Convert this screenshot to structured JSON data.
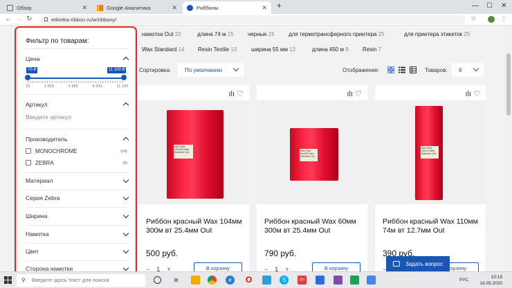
{
  "browser": {
    "tabs": [
      {
        "title": "Обзор",
        "icon": "doc-icon"
      },
      {
        "title": "Google Аналитика",
        "icon": "analytics-icon"
      },
      {
        "title": "Риббоны",
        "icon": "site-icon"
      }
    ],
    "new_tab": "+",
    "url": "etiketka-ribbon.ru/w/ribbony/"
  },
  "tags_row1": [
    {
      "label": "намотка Out",
      "count": "32"
    },
    {
      "label": "длина 74 м",
      "count": "25"
    },
    {
      "label": "черные",
      "count": "25"
    },
    {
      "label": "для термотрансферного принтера",
      "count": "25"
    },
    {
      "label": "для принтера этикеток",
      "count": "25"
    }
  ],
  "tags_row2": [
    {
      "label": "Wax Standard",
      "count": "14"
    },
    {
      "label": "Resin Textile",
      "count": "13"
    },
    {
      "label": "ширина 55 мм",
      "count": "12"
    },
    {
      "label": "длина 450 м",
      "count": "8"
    },
    {
      "label": "Resin",
      "count": "7"
    }
  ],
  "filter": {
    "title": "Фильтр по товарам:",
    "price": {
      "label": "Цена",
      "min_badge": "70 ₽",
      "max_badge": "11 100 ₽",
      "ticks": [
        "70",
        "2 828",
        "5 585",
        "8 343",
        "11 100"
      ]
    },
    "article": {
      "label": "Артикул",
      "placeholder": "Введите артикул"
    },
    "maker": {
      "label": "Производитель",
      "options": [
        {
          "label": "MONOCHROME",
          "count": "(14)",
          "checked": false
        },
        {
          "label": "ZEBRA",
          "count": "(9)",
          "checked": false
        }
      ]
    },
    "collapsed": [
      "Материал",
      "Серия Zebra",
      "Ширина",
      "Намотка",
      "Цвет",
      "Сторона намотки"
    ]
  },
  "sort": {
    "label": "Сортировка:",
    "value": "По умолчанию"
  },
  "display": {
    "label": "Отображение:"
  },
  "goods": {
    "label": "Товаров:",
    "value": "6"
  },
  "products": [
    {
      "name": "Риббон красный Wax 104мм 300м вт 25.4мм Out",
      "price": "500 руб.",
      "qty": "1",
      "cart": "В корзину",
      "label_text": "WAX Red 104х300 Wax Standard Out"
    },
    {
      "name": "Риббон красный Wax 60мм 300м вт 25.4мм Out",
      "price": "790 руб.",
      "qty": "1",
      "cart": "В корзину",
      "label_text": "WAX Red 60х300 Wax Standard Out"
    },
    {
      "name": "Риббон красный Wax 110мм 74м вт 12.7мм Out",
      "price": "390 руб.",
      "qty": "1",
      "cart": "В корзину",
      "label_text": "WAX Red 110х74 Wax Standard Out"
    }
  ],
  "chat": {
    "label": "Задать вопрос"
  },
  "taskbar": {
    "search_placeholder": "Введите здесь текст для поиска",
    "lang": "РУС",
    "time": "10:19",
    "date": "16.05.2020"
  },
  "colors": {
    "accent": "#1a56b4",
    "highlight": "#e0281c"
  }
}
